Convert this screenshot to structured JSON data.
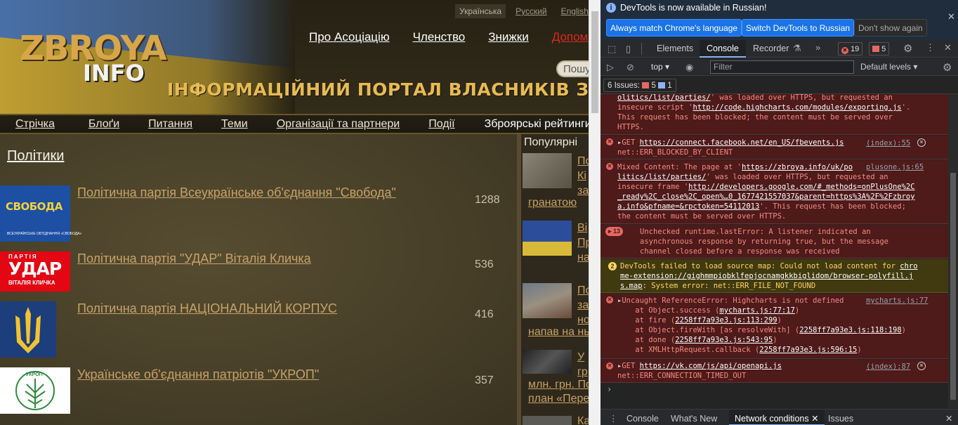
{
  "site": {
    "logo_line1": "ZBROYA",
    "logo_line2": "INFO",
    "slogan": "ІНФОРМАЦІЙНИЙ ПОРТАЛ ВЛАСНИКІВ ЗБРОЇ",
    "languages": [
      "Українська",
      "Русский",
      "English"
    ],
    "top_nav": [
      "Про Асоціацію",
      "Членство",
      "Знижки",
      "Допомо"
    ],
    "search_placeholder": "Пошу",
    "main_nav": [
      "Стрічка",
      "Блоґи",
      "Питання",
      "Теми",
      "Організації та партнери",
      "Події",
      "Зброярські рейтинги"
    ],
    "page_title": "Політики",
    "parties": [
      {
        "name": "Політична партія Всеукраїнське об'єднання \"Свобода\"",
        "count": "1288",
        "logo_text": "СВОБОДА",
        "logo_sub": "ВСЕУКРАЇНСЬКЕ ОБ'ЄДНАННЯ «СВОБОДА»"
      },
      {
        "name": "Політична партія \"УДАР\" Віталія Кличка",
        "count": "536",
        "logo_text": "УДАР",
        "logo_sub": "ВІТАЛІЯ КЛИЧКА",
        "logo_top": "ПАРТІЯ"
      },
      {
        "name": "Політична партія НАЦІОНАЛЬНИЙ КОРПУС",
        "count": "416"
      },
      {
        "name": "Українське об'єднання патріотів \"УКРОП\"",
        "count": "357",
        "logo_text": "УКРОП"
      }
    ],
    "sidebar": {
      "heading": "Популярні",
      "items": [
        {
          "lines": [
            "По",
            "Кі",
            "за"
          ],
          "tail": "гранатою"
        },
        {
          "lines": [
            "Ві",
            "Пр",
            "на"
          ],
          "tail": ""
        },
        {
          "lines": [
            "По",
            "за",
            "но"
          ],
          "tail": "напав на ньо"
        },
        {
          "lines": [
            "У",
            "гр"
          ],
          "tail": "млн. грн. По",
          "tail2": "план «Пере"
        },
        {
          "lines": [
            "Ка"
          ],
          "tail": ""
        }
      ]
    }
  },
  "devtools": {
    "infobar": {
      "message": "DevTools is now available in Russian!",
      "btn_match": "Always match Chrome's language",
      "btn_switch": "Switch DevTools to Russian",
      "btn_dont": "Don't show again"
    },
    "tabs": [
      "Elements",
      "Console",
      "Recorder"
    ],
    "active_tab": "Console",
    "error_count": "19",
    "issue_count_badge": "5",
    "context": "top",
    "filter_placeholder": "Filter",
    "levels": "Default levels",
    "issues_bar": {
      "label": "6 Issues:",
      "errors": "5",
      "info": "1"
    },
    "log": [
      {
        "type": "error",
        "lines": [
          [
            "link",
            "olitics/list/parties/"
          ],
          [
            "text",
            "' was loaded over HTTPS, but requested an"
          ],
          [
            "br"
          ],
          [
            "text",
            "insecure script '"
          ],
          [
            "link",
            "http://code.highcharts.com/modules/exporting.js"
          ],
          [
            "text",
            "'."
          ],
          [
            "br"
          ],
          [
            "text",
            "This request has been blocked; the content must be served over"
          ],
          [
            "br"
          ],
          [
            "text",
            "HTTPS."
          ]
        ]
      },
      {
        "type": "error",
        "line1_pre": "GET ",
        "line1_link": "https://connect.facebook.net/en_US/fbevents.js",
        "line2": "net::ERR_BLOCKED_BY_CLIENT",
        "source": "(index):55"
      },
      {
        "type": "error",
        "source": "plusone.js:65",
        "lines": [
          "Mixed Content: The page at '",
          "https://zbroya.info/uk/po",
          "litics/list/parties/",
          "' was loaded over HTTPS, but requested an",
          "insecure frame '",
          "http://developers.google.com/#_methods=onPlusOne%2C",
          "_ready%2C_close%2C_open%…0_1677421557037&parent=https%3A%2F%2Fzbroy",
          "a.info&pfname=&rpctoken=54112013",
          "'. This request has been blocked;",
          "the content must be served over HTTPS."
        ]
      },
      {
        "type": "error",
        "count": "13",
        "lines": [
          "Unchecked runtime.lastError: A listener indicated an",
          "asynchronous response by returning true, but the message",
          "channel closed before a response was received"
        ]
      },
      {
        "type": "warn",
        "count": "2",
        "lines": [
          "DevTools failed to load source map: Could not load content for ",
          "chro",
          "me-extension://gighmmpiobklfepjocnamgkkbiglidom/browser-polyfill.j",
          "s.map",
          ": System error: net::ERR_FILE_NOT_FOUND"
        ]
      },
      {
        "type": "error",
        "source": "mycharts.js:77",
        "lines": [
          "Uncaught ReferenceError: Highcharts is not defined",
          "    at Object.success (",
          "mycharts.js:77:17",
          ")",
          "    at fire (",
          "2258ff7a93e3.js:113:299",
          ")",
          "    at Object.fireWith [as resolveWith] (",
          "2258ff7a93e3.js:118:198",
          ")",
          "    at done (",
          "2258ff7a93e3.js:543:95",
          ")",
          "    at XMLHttpRequest.callback (",
          "2258ff7a93e3.js:596:15",
          ")"
        ]
      },
      {
        "type": "error",
        "line1_pre": "GET ",
        "line1_link": "https://vk.com/js/api/openapi.js",
        "line2": "net::ERR_CONNECTION_TIMED_OUT",
        "source": "(index):87"
      }
    ],
    "prompt": "›",
    "drawer_tabs": [
      "Console",
      "What's New",
      "Network conditions",
      "Issues"
    ],
    "drawer_active": "Network conditions"
  },
  "colors": {
    "error_bg": "#4e1a1a",
    "warn_bg": "#413a10",
    "accent": "#1a73e8",
    "link_gold": "#c7a26a"
  }
}
